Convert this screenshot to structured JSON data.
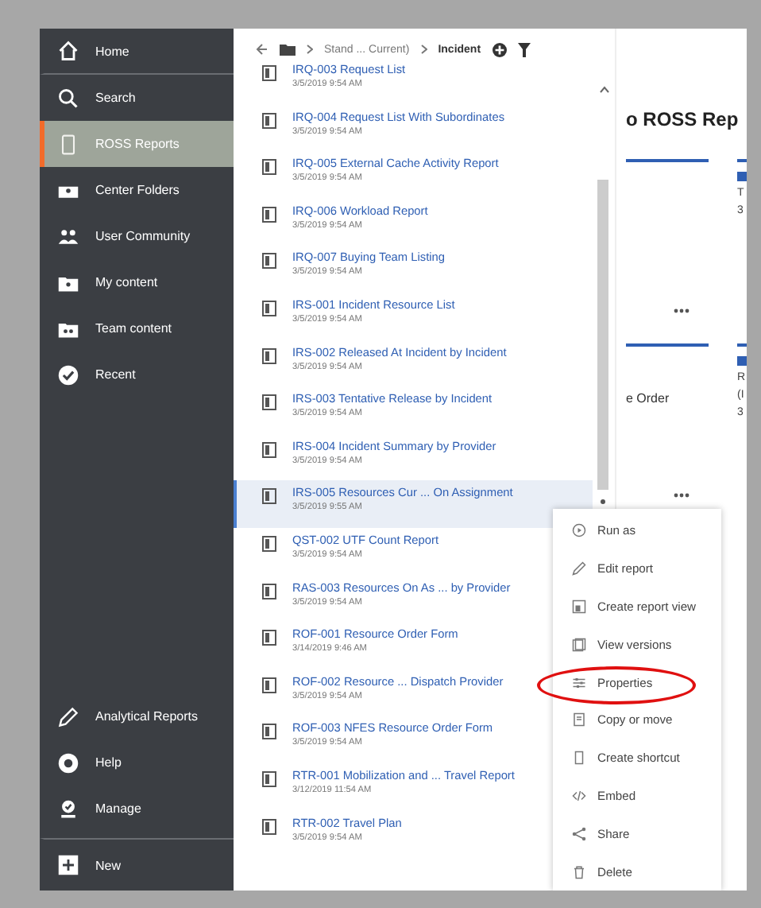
{
  "sidebar": {
    "items": [
      {
        "label": "Home",
        "kind": "home",
        "selected": false
      },
      {
        "label": "Search",
        "kind": "search",
        "selected": false
      },
      {
        "label": "ROSS Reports",
        "kind": "tablet",
        "selected": true
      },
      {
        "label": "Center Folders",
        "kind": "folders",
        "selected": false
      },
      {
        "label": "User Community",
        "kind": "people",
        "selected": false
      },
      {
        "label": "My content",
        "kind": "mycontent",
        "selected": false
      },
      {
        "label": "Team content",
        "kind": "teamcontent",
        "selected": false
      },
      {
        "label": "Recent",
        "kind": "recent",
        "selected": false
      }
    ],
    "bottom_items": [
      {
        "label": "Analytical Reports",
        "kind": "pencil",
        "selected": false
      },
      {
        "label": "Help",
        "kind": "help",
        "selected": false
      },
      {
        "label": "Manage",
        "kind": "manage",
        "selected": false
      },
      {
        "label": "New",
        "kind": "new",
        "selected": false
      }
    ]
  },
  "breadcrumb": {
    "crumbs": [
      "Stand ... Current)",
      "Incident"
    ]
  },
  "reports": [
    {
      "title": "IRQ-003 Request List",
      "date": "3/5/2019 9:54 AM",
      "selected": false
    },
    {
      "title": "IRQ-004 Request List With Subordinates",
      "date": "3/5/2019 9:54 AM",
      "selected": false
    },
    {
      "title": "IRQ-005 External Cache Activity Report",
      "date": "3/5/2019 9:54 AM",
      "selected": false
    },
    {
      "title": "IRQ-006 Workload Report",
      "date": "3/5/2019 9:54 AM",
      "selected": false
    },
    {
      "title": "IRQ-007 Buying Team Listing",
      "date": "3/5/2019 9:54 AM",
      "selected": false
    },
    {
      "title": "IRS-001 Incident Resource List",
      "date": "3/5/2019 9:54 AM",
      "selected": false
    },
    {
      "title": "IRS-002 Released At Incident by Incident",
      "date": "3/5/2019 9:54 AM",
      "selected": false
    },
    {
      "title": "IRS-003 Tentative Release by Incident",
      "date": "3/5/2019 9:54 AM",
      "selected": false
    },
    {
      "title": "IRS-004 Incident Summary by Provider",
      "date": "3/5/2019 9:54 AM",
      "selected": false
    },
    {
      "title": "IRS-005 Resources Cur ... On Assignment",
      "date": "3/5/2019 9:55 AM",
      "selected": true
    },
    {
      "title": "QST-002 UTF Count Report",
      "date": "3/5/2019 9:54 AM",
      "selected": false
    },
    {
      "title": "RAS-003 Resources On As ... by Provider",
      "date": "3/5/2019 9:54 AM",
      "selected": false
    },
    {
      "title": "ROF-001 Resource Order Form",
      "date": "3/14/2019 9:46 AM",
      "selected": false
    },
    {
      "title": "ROF-002 Resource ... Dispatch Provider",
      "date": "3/5/2019 9:54 AM",
      "selected": false
    },
    {
      "title": "ROF-003 NFES Resource Order Form",
      "date": "3/5/2019 9:54 AM",
      "selected": false
    },
    {
      "title": "RTR-001 Mobilization and ... Travel Report",
      "date": "3/12/2019 11:54 AM",
      "selected": false
    },
    {
      "title": "RTR-002 Travel Plan",
      "date": "3/5/2019 9:54 AM",
      "selected": false
    }
  ],
  "content": {
    "heading": "o ROSS Rep",
    "cards": [
      {
        "edge_texts": [
          "T",
          "3"
        ]
      },
      {
        "text": "e Order",
        "edge_texts": [
          "R",
          "(I",
          "3"
        ]
      }
    ]
  },
  "context_menu": {
    "items": [
      {
        "label": "Run as",
        "kind": "run",
        "circled": false
      },
      {
        "label": "Edit report",
        "kind": "edit",
        "circled": false
      },
      {
        "label": "Create report view",
        "kind": "view",
        "circled": false
      },
      {
        "label": "View versions",
        "kind": "versions",
        "circled": false
      },
      {
        "label": "Properties",
        "kind": "properties",
        "circled": true
      },
      {
        "label": "Copy or move",
        "kind": "copy",
        "circled": false
      },
      {
        "label": "Create shortcut",
        "kind": "shortcut",
        "circled": false
      },
      {
        "label": "Embed",
        "kind": "embed",
        "circled": false
      },
      {
        "label": "Share",
        "kind": "share",
        "circled": false
      },
      {
        "label": "Delete",
        "kind": "delete",
        "circled": false
      }
    ]
  }
}
